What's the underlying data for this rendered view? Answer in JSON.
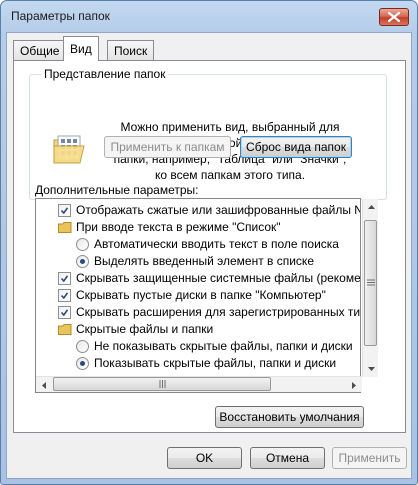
{
  "window": {
    "title": "Параметры папок"
  },
  "tabs": [
    {
      "label": "Общие",
      "active": false
    },
    {
      "label": "Вид",
      "active": true
    },
    {
      "label": "Поиск",
      "active": false
    }
  ],
  "folder_view": {
    "group_label": "Представление папок",
    "description_lines": [
      "Можно применить вид, выбранный для этой",
      "папки, например, \"Таблица\" или \"Значки\",",
      "ко всем папкам этого типа."
    ],
    "apply_button_label": "Применить к папкам",
    "reset_button_label": "Сброс вида папок"
  },
  "advanced": {
    "label": "Дополнительные параметры:",
    "items": [
      {
        "kind": "checkbox",
        "checked": true,
        "indent": 0,
        "text": "Отображать сжатые или зашифрованные файлы NTF"
      },
      {
        "kind": "folder",
        "indent": 0,
        "text": "При вводе текста в режиме \"Список\""
      },
      {
        "kind": "radio",
        "checked": false,
        "indent": 1,
        "text": "Автоматически вводить текст в поле поиска"
      },
      {
        "kind": "radio",
        "checked": true,
        "indent": 1,
        "text": "Выделять введенный элемент в списке"
      },
      {
        "kind": "checkbox",
        "checked": true,
        "indent": 0,
        "text": "Скрывать защищенные системные файлы (рекомен"
      },
      {
        "kind": "checkbox",
        "checked": true,
        "indent": 0,
        "text": "Скрывать пустые диски в папке \"Компьютер\""
      },
      {
        "kind": "checkbox",
        "checked": true,
        "indent": 0,
        "text": "Скрывать расширения для зарегистрированных типо"
      },
      {
        "kind": "folder",
        "indent": 0,
        "text": "Скрытые файлы и папки"
      },
      {
        "kind": "radio",
        "checked": false,
        "indent": 1,
        "text": "Не показывать скрытые файлы, папки и диски"
      },
      {
        "kind": "radio",
        "checked": true,
        "indent": 1,
        "text": "Показывать скрытые файлы, папки и диски"
      }
    ],
    "restore_button_label": "Восстановить умолчания"
  },
  "footer": {
    "ok_label": "OK",
    "cancel_label": "Отмена",
    "apply_label": "Применить"
  },
  "colors": {
    "check_mark": "#2b4a7a",
    "folder": "#e9c35b"
  }
}
